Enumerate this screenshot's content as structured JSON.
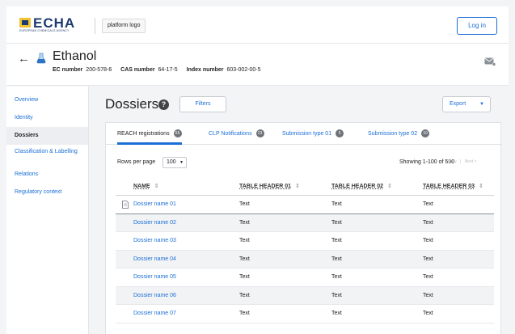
{
  "header": {
    "brand": "ECHA",
    "brand_sub": "EUROPEAN CHEMICALS AGENCY",
    "platform_logo": "platform logo",
    "login_label": "Log in",
    "accent": "#1b6fd6"
  },
  "substance": {
    "name": "Ethanol",
    "ec_label": "EC number",
    "ec_value": "200-578-6",
    "cas_label": "CAS number",
    "cas_value": "64-17-5",
    "index_label": "Index number",
    "index_value": "603-002-00-5"
  },
  "sidebar": {
    "items": [
      {
        "label": "Overview"
      },
      {
        "label": "Identity"
      },
      {
        "label": "Dossiers"
      },
      {
        "label": "Classification & Labelling"
      },
      {
        "label": "Relations"
      },
      {
        "label": "Regulatory context"
      }
    ]
  },
  "main": {
    "title": "Dossiers",
    "help": "?",
    "filters_label": "Filters",
    "export_label": "Export",
    "tabs": [
      {
        "label": "REACH registrations",
        "badge": "55"
      },
      {
        "label": "CLP Notifications",
        "badge": "23"
      },
      {
        "label": "Submission type 01",
        "badge": "5"
      },
      {
        "label": "Submission type 02",
        "badge": "10"
      }
    ],
    "rows_per_page_label": "Rows per page",
    "rows_per_page_value": "100",
    "showing": "Showing 1-100 of 500",
    "prev": "< Prev",
    "next": "Next >",
    "columns": [
      "NAME",
      "TABLE HEADER 01",
      "TABLE HEADER 02",
      "TABLE HEADER 03"
    ],
    "sort_glyph": "⇕",
    "rows": [
      {
        "name": "Dossier name 01",
        "c1": "Text",
        "c2": "Text",
        "c3": "Text"
      },
      {
        "name": "Dossier name 02",
        "c1": "Text",
        "c2": "Text",
        "c3": "Text"
      },
      {
        "name": "Dossier name 03",
        "c1": "Text",
        "c2": "Text",
        "c3": "Text"
      },
      {
        "name": "Dossier name 04",
        "c1": "Text",
        "c2": "Text",
        "c3": "Text"
      },
      {
        "name": "Dossier name 05",
        "c1": "Text",
        "c2": "Text",
        "c3": "Text"
      },
      {
        "name": "Dossier name 06",
        "c1": "Text",
        "c2": "Text",
        "c3": "Text"
      },
      {
        "name": "Dossier name 07",
        "c1": "Text",
        "c2": "Text",
        "c3": "Text"
      }
    ]
  }
}
